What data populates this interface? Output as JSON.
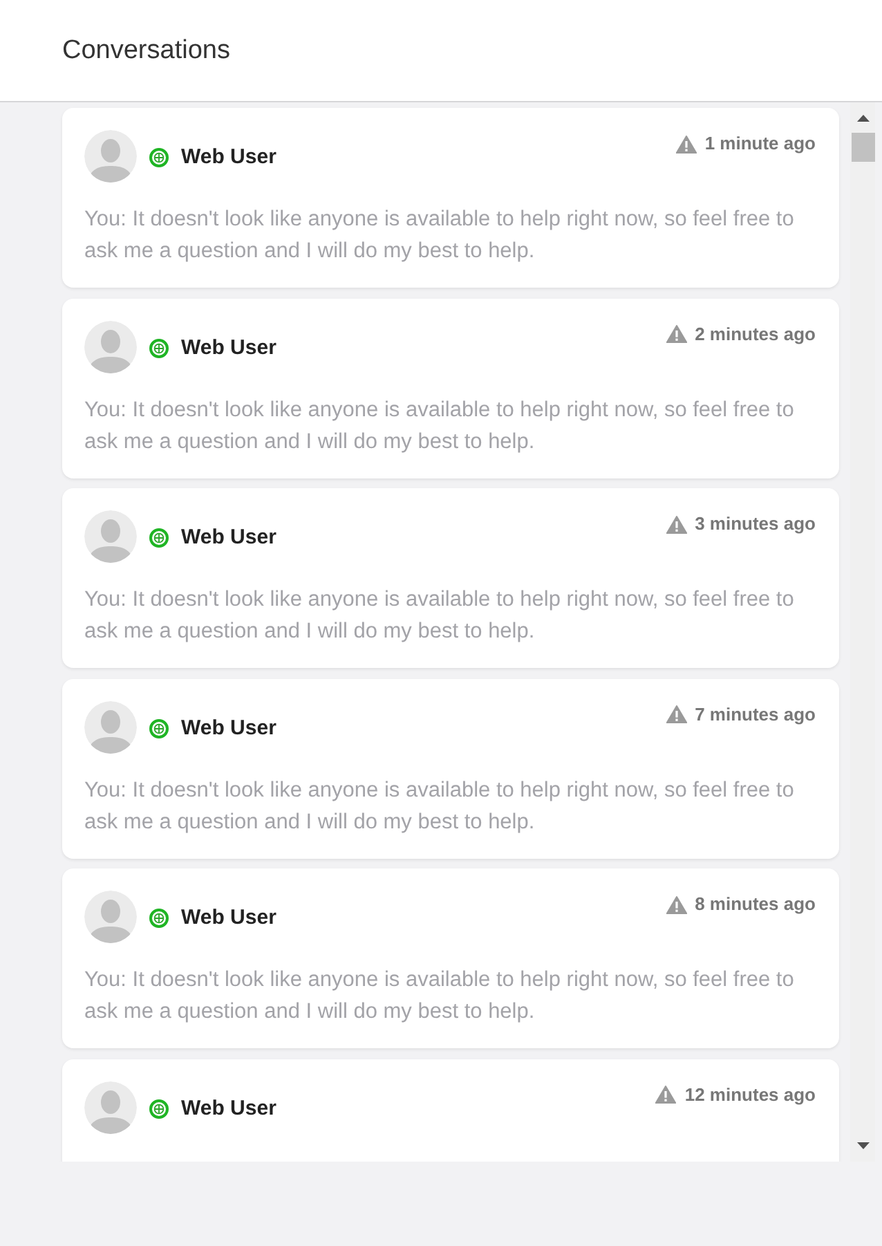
{
  "header": {
    "title": "Conversations"
  },
  "conversations": [
    {
      "name": "Web User",
      "time": "1 minute ago",
      "message": "You: It doesn't look like anyone is available to help right now, so feel free to ask me a question and I will do my best to help."
    },
    {
      "name": "Web User",
      "time": "2 minutes ago",
      "message": "You: It doesn't look like anyone is available to help right now, so feel free to ask me a question and I will do my best to help."
    },
    {
      "name": "Web User",
      "time": "3 minutes ago",
      "message": "You: It doesn't look like anyone is available to help right now, so feel free to ask me a question and I will do my best to help."
    },
    {
      "name": "Web User",
      "time": "7 minutes ago",
      "message": "You: It doesn't look like anyone is available to help right now, so feel free to ask me a question and I will do my best to help."
    },
    {
      "name": "Web User",
      "time": "8 minutes ago",
      "message": "You: It doesn't look like anyone is available to help right now, so feel free to ask me a question and I will do my best to help."
    },
    {
      "name": "Web User",
      "time": "12 minutes ago"
    }
  ]
}
